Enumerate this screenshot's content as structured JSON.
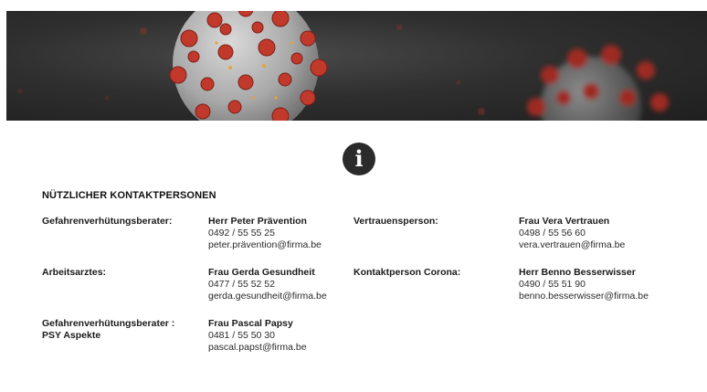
{
  "banner": {
    "description_icon": "coronavirus-banner"
  },
  "info": {
    "icon": "info-icon"
  },
  "section": {
    "title": "NÜTZLICHER KONTAKTPERSONEN"
  },
  "contacts": [
    {
      "role": "Gefahrenverhütungsberater:",
      "role_line2": "",
      "name": "Herr Peter Prävention",
      "phone": "0492 / 55 55 25",
      "email": "peter.prävention@firma.be"
    },
    {
      "role": "Vertrauensperson:",
      "role_line2": "",
      "name": "Frau Vera Vertrauen",
      "phone": "0498 / 55 56 60",
      "email": "vera.vertrauen@firma.be"
    },
    {
      "role": "Arbeitsarztes:",
      "role_line2": "",
      "name": "Frau Gerda Gesundheit",
      "phone": "0477 / 55 52 52",
      "email": "gerda.gesundheit@firma.be"
    },
    {
      "role": "Kontaktperson Corona:",
      "role_line2": "",
      "name": "Herr Benno Besserwisser",
      "phone": "0490 / 55 51 90",
      "email": "benno.besserwisser@firma.be"
    },
    {
      "role": "Gefahrenverhütungsberater :",
      "role_line2": "PSY Aspekte",
      "name": "Frau Pascal Papsy",
      "phone": "0481 / 55 50 30",
      "email": "pascal.papst@firma.be"
    }
  ]
}
